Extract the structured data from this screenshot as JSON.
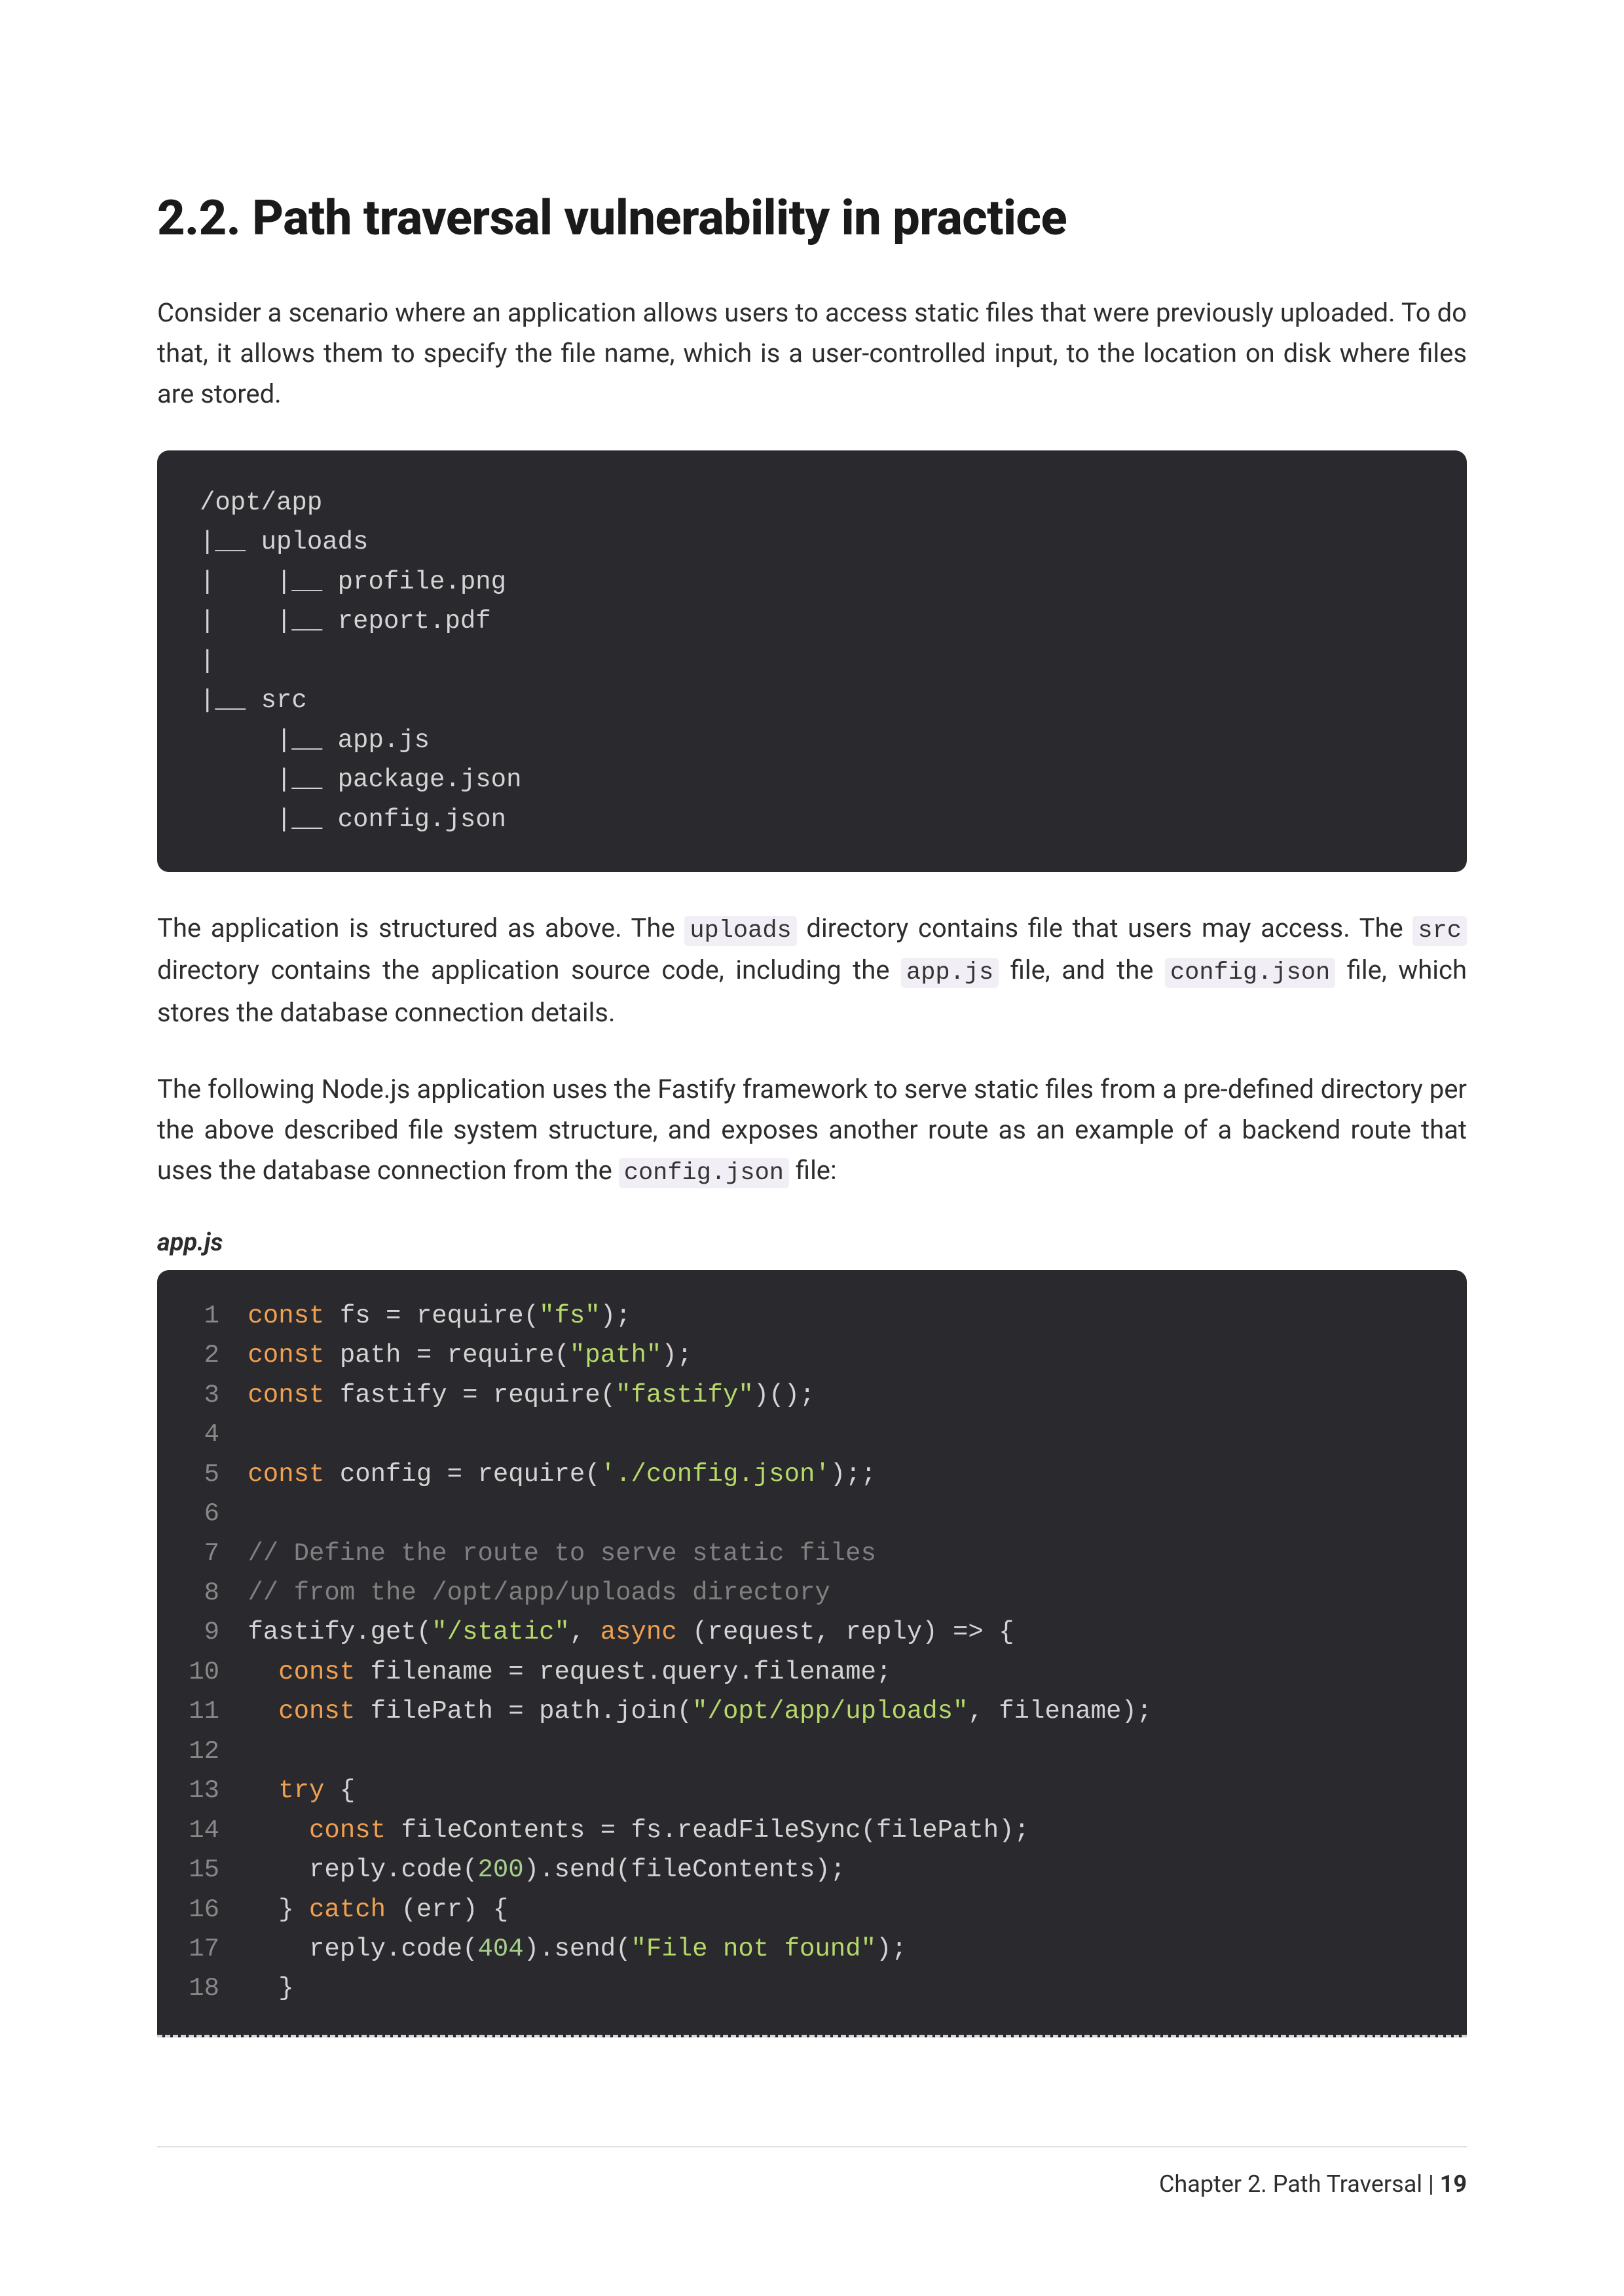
{
  "heading": "2.2. Path traversal vulnerability in practice",
  "para1": "Consider a scenario where an application allows users to access static files that were previously uploaded. To do that, it allows them to specify the file name, which is a user-controlled input, to the location on disk where files are stored.",
  "tree": "/opt/app\n|__ uploads\n|    |__ profile.png\n|    |__ report.pdf\n|\n|__ src\n     |__ app.js\n     |__ package.json\n     |__ config.json",
  "para2_pre": "The application is structured as above. The ",
  "para2_code1": "uploads",
  "para2_mid1": " directory contains file that users may access. The ",
  "para2_code2": "src",
  "para2_mid2": " directory contains the application source code, including the ",
  "para2_code3": "app.js",
  "para2_mid3": " file, and the ",
  "para2_code4": "config.json",
  "para2_post": " file, which stores the database connection details.",
  "para3_pre": "The following Node.js application uses the Fastify framework to serve static files from a pre-defined directory per the above described file system structure, and exposes another route as an example of a backend route that uses the database connection from the ",
  "para3_code1": "config.json",
  "para3_post": " file:",
  "code_caption": "app.js",
  "code": {
    "l1": {
      "kw": "const",
      "rest": " fs = require(",
      "str": "\"fs\"",
      "end": ");"
    },
    "l2": {
      "kw": "const",
      "rest": " path = require(",
      "str": "\"path\"",
      "end": ");"
    },
    "l3": {
      "kw": "const",
      "rest": " fastify = require(",
      "str": "\"fastify\"",
      "end": ")();"
    },
    "l5": {
      "kw": "const",
      "rest": " config = require(",
      "str": "'./config.json'",
      "end": ");;"
    },
    "l7": "// Define the route to serve static files",
    "l8": "// from the /opt/app/uploads directory",
    "l9": {
      "pre": "fastify.get(",
      "str": "\"/static\"",
      "mid": ", ",
      "kw": "async",
      "post": " (request, reply) => {"
    },
    "l10": {
      "indent": "   ",
      "kw": "const",
      "rest": " filename = request.query.filename;"
    },
    "l11": {
      "indent": "   ",
      "kw": "const",
      "rest": " filePath = path.join(",
      "str": "\"/opt/app/uploads\"",
      "end": ", filename);"
    },
    "l13": {
      "indent": "   ",
      "kw": "try",
      "rest": " {"
    },
    "l14": {
      "indent": "     ",
      "kw": "const",
      "rest": " fileContents = fs.readFileSync(filePath);"
    },
    "l15": {
      "indent": "     ",
      "pre": "reply.code(",
      "num": "200",
      "post": ").send(fileContents);"
    },
    "l16": {
      "indent": "   } ",
      "kw": "catch",
      "rest": " (err) {"
    },
    "l17": {
      "indent": "     ",
      "pre": "reply.code(",
      "num": "404",
      "post": ").send(",
      "str": "\"File not found\"",
      "end": ");"
    },
    "l18": "   }"
  },
  "footer": {
    "chapter": "Chapter 2. Path Traversal",
    "sep": " | ",
    "page": "19"
  }
}
